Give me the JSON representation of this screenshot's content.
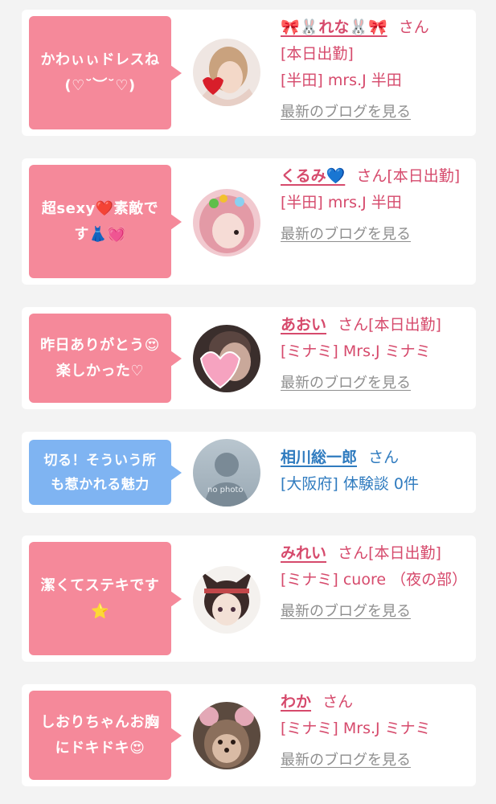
{
  "items": [
    {
      "comment": "かわぃぃドレスね(♡˘︶˘♡)",
      "comment_lines": [
        "かわぃぃドレスね",
        "(♡˘︶˘♡)"
      ],
      "name": "🎀🐰れな🐰🎀",
      "honorific": "さん",
      "status": "[本日出勤]",
      "shop": "[半田] mrs.J 半田",
      "blog_link": "最新のブログを見る",
      "bubble_color": "#f5899a"
    },
    {
      "comment": "超sexy❤️素敵です👗💓",
      "comment_lines": [
        "超sexy❤️素敵で",
        "す👗💓"
      ],
      "name": "くるみ💙",
      "honorific": "さん",
      "status": "[本日出勤]",
      "shop": "[半田] mrs.J 半田",
      "blog_link": "最新のブログを見る",
      "bubble_color": "#f5899a"
    },
    {
      "comment": "昨日ありがとう😍楽しかった♡",
      "comment_lines": [
        "昨日ありがとう😍",
        "楽しかった♡"
      ],
      "name": "あおい",
      "honorific": "さん",
      "status": "[本日出勤]",
      "shop": "[ミナミ] Mrs.J ミナミ",
      "blog_link": "最新のブログを見る",
      "bubble_color": "#f5899a"
    },
    {
      "comment": "切る！そういう所も惹かれる魅力",
      "comment_lines": [
        "切る！そういう所",
        "も惹かれる魅力"
      ],
      "name": "相川総一郎",
      "honorific": "さん",
      "shop": "[大阪府] 体験談 0件",
      "avatar_text": "no photo",
      "bubble_color": "#7fb4f2"
    },
    {
      "comment": "潔くてステキです⭐",
      "comment_lines": [
        "潔くてステキです",
        "⭐"
      ],
      "name": "みれい",
      "honorific": "さん",
      "status": "[本日出勤]",
      "shop": "[ミナミ] cuore （夜の部）",
      "blog_link": "最新のブログを見る",
      "bubble_color": "#f5899a"
    },
    {
      "comment": "しおりちゃんお胸にドキドキ😍",
      "comment_lines": [
        "しおりちゃんお胸",
        "にドキドキ😍"
      ],
      "name": "わか",
      "honorific": "さん",
      "shop": "[ミナミ] Mrs.J ミナミ",
      "blog_link": "最新のブログを見る",
      "bubble_color": "#f5899a"
    }
  ],
  "colors": {
    "pink_text": "#d64a6c",
    "blue_text": "#2f7bbf",
    "link_gray": "#8e8e8e"
  }
}
